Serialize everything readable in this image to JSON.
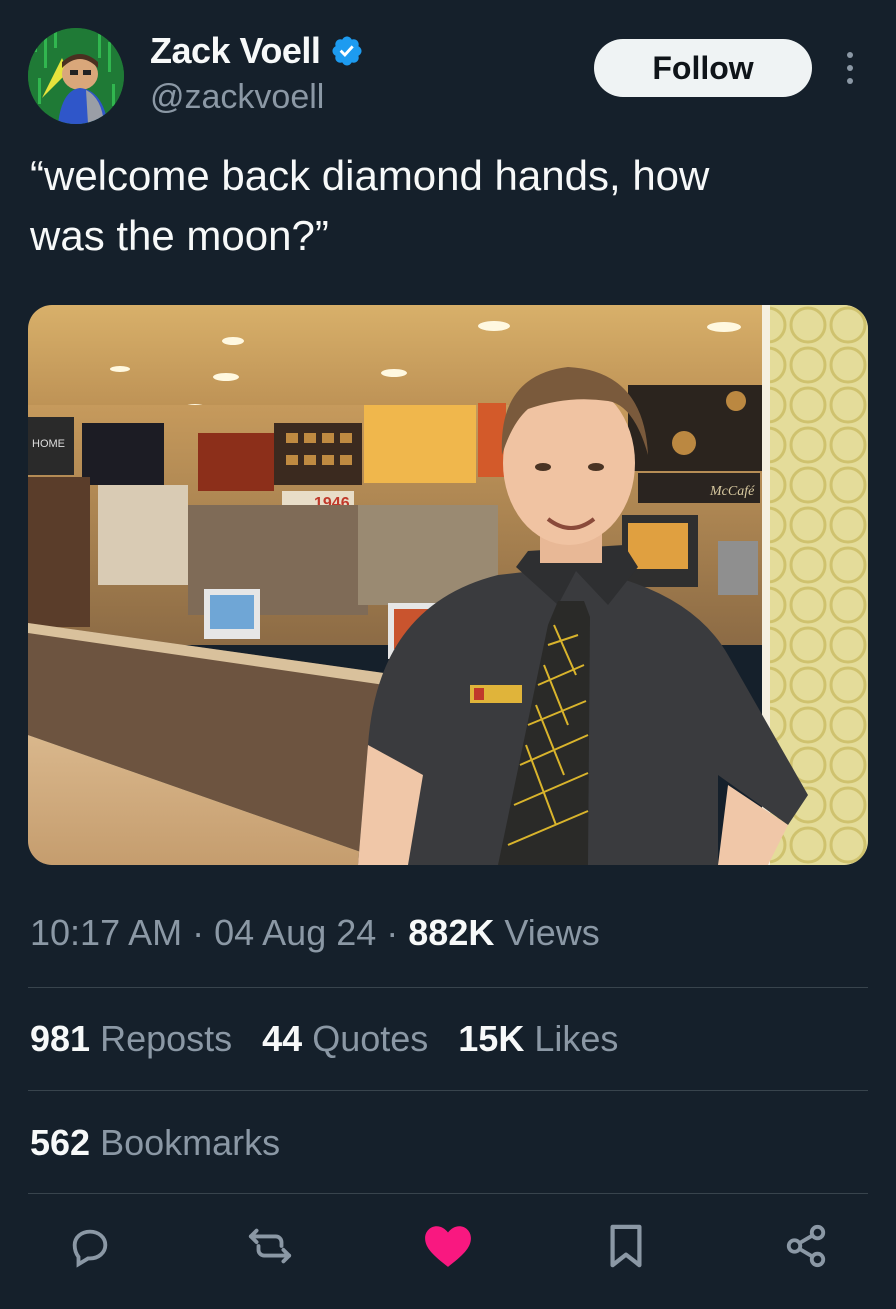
{
  "author": {
    "display_name": "Zack Voell",
    "handle": "@zackvoell",
    "verified": true
  },
  "header": {
    "follow_label": "Follow"
  },
  "tweet": {
    "text": "“welcome back diamond hands, how\nwas the moon?”"
  },
  "media": {
    "signage": {
      "board_left": "HOME",
      "board_year": "1946",
      "badge_brand": "McCafé"
    }
  },
  "meta": {
    "time": "10:17 AM",
    "sep1": " · ",
    "date": "04 Aug 24",
    "sep2": " · ",
    "views_count": "882K",
    "views_label": " Views"
  },
  "stats": {
    "reposts_count": "981",
    "reposts_label": "Reposts",
    "quotes_count": "44",
    "quotes_label": "Quotes",
    "likes_count": "15K",
    "likes_label": "Likes",
    "bookmarks_count": "562",
    "bookmarks_label": "Bookmarks"
  },
  "actions": [
    {
      "icon": "reply-icon"
    },
    {
      "icon": "repost-icon"
    },
    {
      "icon": "like-icon",
      "active": true,
      "color": "#f91880"
    },
    {
      "icon": "bookmark-icon"
    },
    {
      "icon": "share-icon"
    }
  ],
  "colors": {
    "background": "#15202b",
    "secondary_text": "#8b98a5",
    "verified": "#1d9bf0",
    "like_active": "#f91880"
  }
}
